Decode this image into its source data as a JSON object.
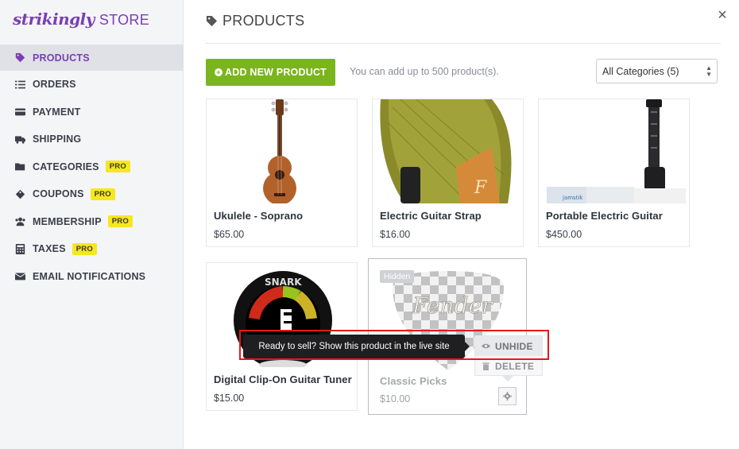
{
  "app": {
    "logo_word": "strikingly",
    "logo_store": "STORE",
    "brand_color": "#7a3eb5",
    "accent_green": "#7ab51d"
  },
  "sidebar": {
    "items": [
      {
        "label": "PRODUCTS",
        "icon": "tag-icon",
        "active": true
      },
      {
        "label": "ORDERS",
        "icon": "list-icon"
      },
      {
        "label": "PAYMENT",
        "icon": "credit-card-icon"
      },
      {
        "label": "SHIPPING",
        "icon": "truck-icon"
      },
      {
        "label": "CATEGORIES",
        "icon": "folder-icon",
        "badge": "PRO"
      },
      {
        "label": "COUPONS",
        "icon": "ticket-icon",
        "badge": "PRO"
      },
      {
        "label": "MEMBERSHIP",
        "icon": "users-icon",
        "badge": "PRO"
      },
      {
        "label": "TAXES",
        "icon": "calculator-icon",
        "badge": "PRO"
      },
      {
        "label": "EMAIL NOTIFICATIONS",
        "icon": "envelope-icon"
      }
    ]
  },
  "header": {
    "title": "PRODUCTS",
    "close_glyph": "×"
  },
  "toolbar": {
    "add_label": "ADD NEW PRODUCT",
    "hint": "You can add up to 500 product(s).",
    "category_select": "All Categories (5)"
  },
  "products": [
    {
      "name": "Ukulele - Soprano",
      "price": "$65.00",
      "image": "ukulele-image"
    },
    {
      "name": "Electric Guitar Strap",
      "price": "$16.00",
      "image": "guitar-strap-image"
    },
    {
      "name": "Portable Electric Guitar",
      "price": "$450.00",
      "image": "portable-guitar-image"
    },
    {
      "name": "Digital Clip-On Guitar Tuner",
      "price": "$15.00",
      "image": "tuner-image",
      "image_text": "SNARK"
    },
    {
      "name": "Classic Picks",
      "price": "$10.00",
      "image": "guitar-pick-image",
      "hidden": true,
      "hidden_label": "Hidden",
      "image_text": "Fender"
    }
  ],
  "context_menu": {
    "unhide": "UNHIDE",
    "delete": "DELETE"
  },
  "tooltip": {
    "text": "Ready to sell? Show this product in the live site"
  }
}
